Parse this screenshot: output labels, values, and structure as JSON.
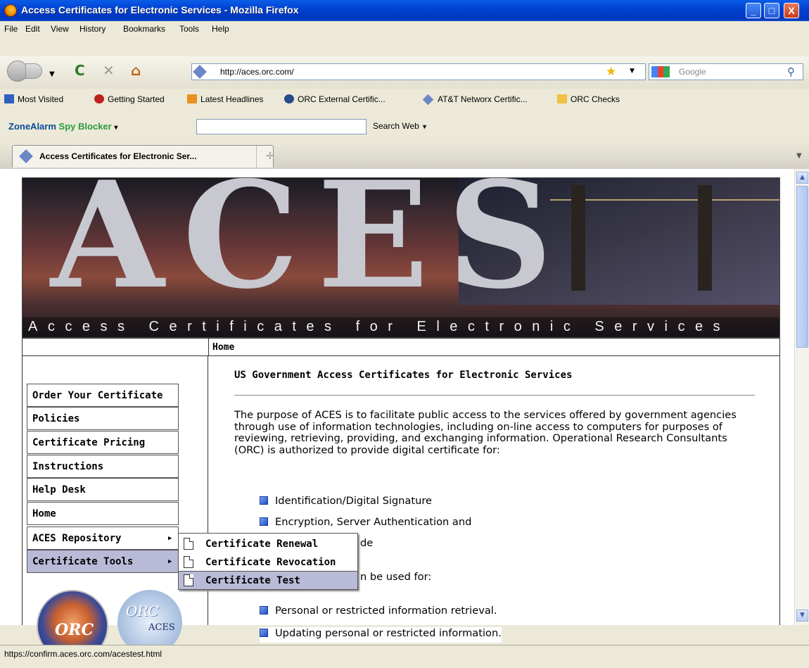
{
  "window": {
    "title": "Access Certificates for Electronic Services - Mozilla Firefox",
    "minimize_glyph": "_",
    "maximize_glyph": "□",
    "close_glyph": "X"
  },
  "menubar": [
    "File",
    "Edit",
    "View",
    "History",
    "Bookmarks",
    "Tools",
    "Help"
  ],
  "navbar": {
    "url": "http://aces.orc.com/",
    "search_placeholder": "Google"
  },
  "bookmarks": [
    {
      "label": "Most Visited",
      "icon": "most-visited-icon",
      "color": "#3060c0"
    },
    {
      "label": "Getting Started",
      "icon": "firefox-getting-started-icon",
      "color": "#c02020"
    },
    {
      "label": "Latest Headlines",
      "icon": "rss-feed-icon",
      "color": "#e89020"
    },
    {
      "label": "ORC External Certific...",
      "icon": "globe-icon",
      "color": "#2a4a8a"
    },
    {
      "label": "AT&T Networx Certific...",
      "icon": "site-diamond-icon",
      "color": "#6c86c6"
    },
    {
      "label": "ORC Checks",
      "icon": "folder-icon",
      "color": "#f0c040"
    }
  ],
  "zonealarm": {
    "brand": "ZoneAlarm",
    "product": "Spy Blocker",
    "search_web": "Search Web"
  },
  "tab": {
    "label": "Access Certificates for Electronic Ser..."
  },
  "status": {
    "text": "https://confirm.aces.orc.com/acestest.html"
  },
  "page": {
    "banner_letters": "ACES",
    "banner_subtitle": "Access Certificates for Electronic Services",
    "breadcrumb": "Home",
    "menu": [
      {
        "label": "Order Your Certificate"
      },
      {
        "label": "Policies"
      },
      {
        "label": "Certificate Pricing"
      },
      {
        "label": "Instructions"
      },
      {
        "label": "Help Desk"
      },
      {
        "label": "Home"
      },
      {
        "label": "ACES Repository"
      },
      {
        "label": "Certificate Tools"
      }
    ],
    "submenu": [
      "Certificate Renewal",
      "Certificate Revocation",
      "Certificate Test"
    ],
    "heading": "US Government Access Certificates for Electronic Services",
    "paragraph": "The purpose of ACES is to facilitate public access to the services offered by government agencies through use of information technologies, including on-line access to computers for purposes of reviewing, retrieving, providing, and exchanging information. Operational Research Consultants (ORC) is authorized to provide digital certificate for:",
    "bullets1": [
      "Identification/Digital Signature",
      "Encryption, Server Authentication and"
    ],
    "frag1": "de",
    "frag2": "n be used for:",
    "bullets2": [
      "Personal or restricted information retrieval.",
      "Updating personal or restricted information."
    ],
    "logo1_text": "ORC",
    "logo2_text": "ORC",
    "logo2_sub": "ACES"
  }
}
